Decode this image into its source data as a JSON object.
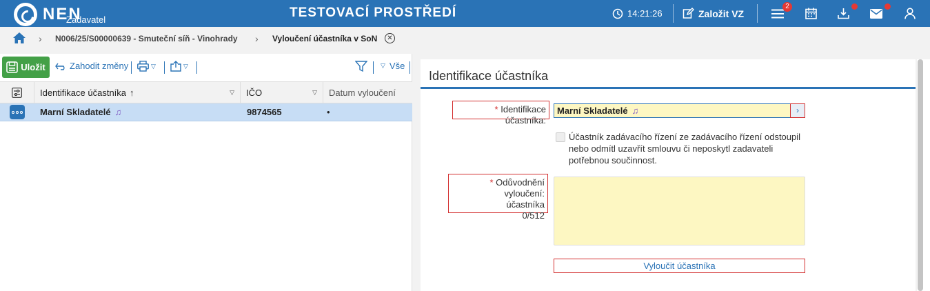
{
  "header": {
    "logo_text": "NEN",
    "logo_subtitle": "Zadavatel",
    "environment_title": "TESTOVACÍ PROSTŘEDÍ",
    "clock": "14:21:26",
    "new_contract_label": "Založit VZ",
    "menu_badge": "2",
    "colors": {
      "bar": "#2a73b6",
      "badge": "#e53935"
    }
  },
  "breadcrumb": {
    "items": [
      "N006/25/S00000639 - Smuteční síň - Vinohrady"
    ],
    "current": "Vyloučení účastníka v SoN"
  },
  "toolbar": {
    "save_label": "Uložit",
    "discard_label": "Zahodit změny",
    "filter_all_label": "Vše"
  },
  "grid": {
    "columns": [
      "Identifikace účastníka",
      "IČO",
      "Datum vyloučení"
    ],
    "rows": [
      {
        "name": "Marní Skladatelé",
        "ico": "9874565",
        "date": "•"
      }
    ]
  },
  "form": {
    "title": "Identifikace účastníka",
    "ident_label": "Identifikace účastníka:",
    "ident_value": "Marní Skladatelé",
    "checkbox_label": "Účastník zadávacího řízení ze zadávacího řízení odstoupil nebo odmítl uzavřít smlouvu či neposkytl zadavateli potřebnou součinnost.",
    "reason_label_line1": "Odůvodnění vyloučení:",
    "reason_label_line2": "účastníka",
    "reason_counter": "0/512",
    "reason_value": "",
    "exclude_button": "Vyloučit účastníka"
  }
}
